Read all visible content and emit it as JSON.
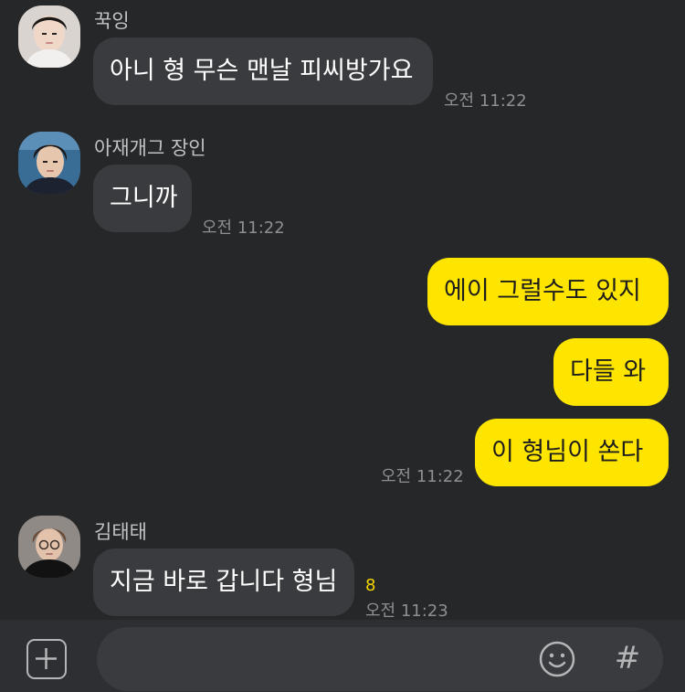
{
  "messages_incoming": [
    {
      "sender": "꾹잉",
      "text": "아니 형 무슨 맨날 피씨방가요",
      "time": "오전 11:22"
    },
    {
      "sender": "아재개그 장인",
      "text": "그니까",
      "time": "오전 11:22"
    }
  ],
  "messages_outgoing": [
    {
      "text": "에이 그럴수도 있지"
    },
    {
      "text": "다들 와"
    },
    {
      "text": "이 형님이 쏜다",
      "time": "오전 11:22"
    }
  ],
  "last_message": {
    "sender": "김태태",
    "text": "지금 바로 갑니다 형님",
    "unread_count": "8",
    "time": "오전 11:23"
  },
  "input_bar": {
    "plus_icon": "plus-square-icon",
    "emoji_icon": "smiley-icon",
    "hash_icon": "hash-icon",
    "hash_label": "#",
    "message_value": "",
    "placeholder": ""
  },
  "colors": {
    "background": "#262729",
    "incoming_bubble": "#3a3b3e",
    "outgoing_bubble": "#fee500",
    "unread_count": "#f5d500",
    "timestamp": "#8e8f92"
  }
}
